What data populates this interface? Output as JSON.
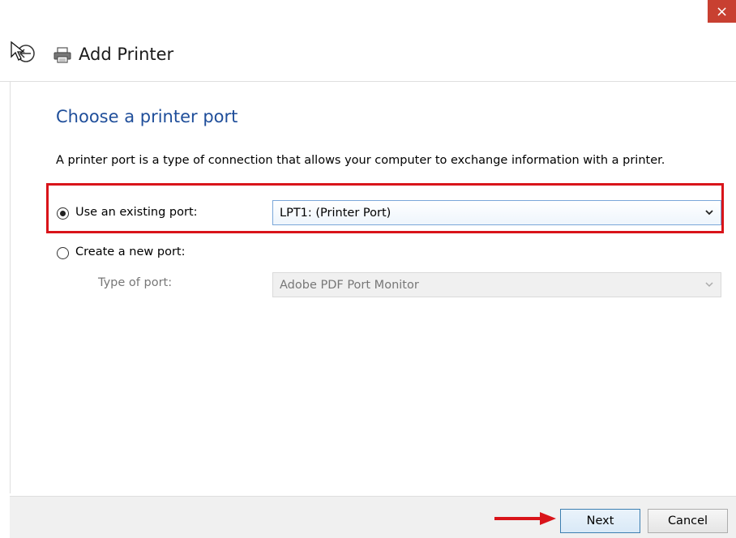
{
  "window": {
    "title": "Add Printer",
    "close_glyph": "×"
  },
  "icons": {
    "back": "back-arrow-icon",
    "printer": "printer-icon",
    "close": "close-icon",
    "dropdown": "chevron-down-icon",
    "annotation_arrow": "red-arrow-icon"
  },
  "content": {
    "heading": "Choose a printer port",
    "description": "A printer port is a type of connection that allows your computer to exchange information with a printer.",
    "existing_port": {
      "label": "Use an existing port:",
      "selected": true,
      "value": "LPT1: (Printer Port)"
    },
    "new_port": {
      "label": "Create a new port:",
      "selected": false,
      "type_label": "Type of port:",
      "type_value": "Adobe PDF Port Monitor"
    }
  },
  "footer": {
    "next_label": "Next",
    "cancel_label": "Cancel"
  },
  "colors": {
    "heading": "#1f4e9a",
    "highlight": "#d9141a",
    "close_button": "#c84031"
  }
}
